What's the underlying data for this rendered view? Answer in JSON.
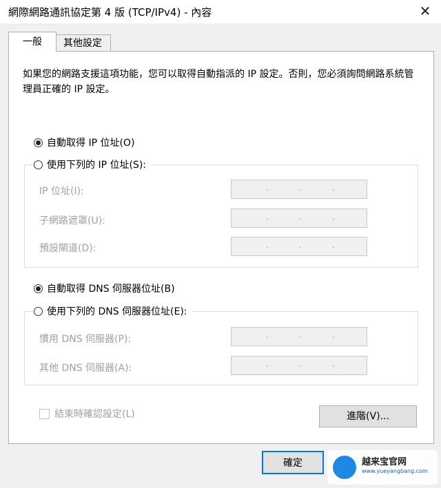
{
  "window": {
    "title": "網際網路通訊協定第 4 版 (TCP/IPv4) - 內容",
    "close_label": "✕"
  },
  "tabs": {
    "general": "一般",
    "other": "其他設定"
  },
  "description": "如果您的網路支援這項功能，您可以取得自動指派的 IP 設定。否則，您必須詢問網路系統管理員正確的 IP 設定。",
  "ip": {
    "auto_label": "自動取得 IP 位址(O)",
    "manual_label": "使用下列的 IP 位址(S):",
    "fields": {
      "ip": "IP 位址(I):",
      "mask": "子網路遮罩(U):",
      "gateway": "預設閘道(D):"
    }
  },
  "dns": {
    "auto_label": "自動取得 DNS 伺服器位址(B)",
    "manual_label": "使用下列的 DNS 伺服器位址(E):",
    "fields": {
      "preferred": "慣用 DNS 伺服器(P):",
      "alternate": "其他 DNS 伺服器(A):"
    }
  },
  "validate_label": "結束時確認設定(L)",
  "advanced_button": "進階(V)...",
  "ok_button": "確定",
  "ip_separator": ".",
  "watermark": {
    "text": "越来宝官网",
    "url": "www.yueyangbang.com"
  },
  "selected": {
    "ip": "auto",
    "dns": "auto"
  },
  "colors": {
    "focus_border": "#0078d7",
    "disabled_text": "#a0a0a0"
  }
}
